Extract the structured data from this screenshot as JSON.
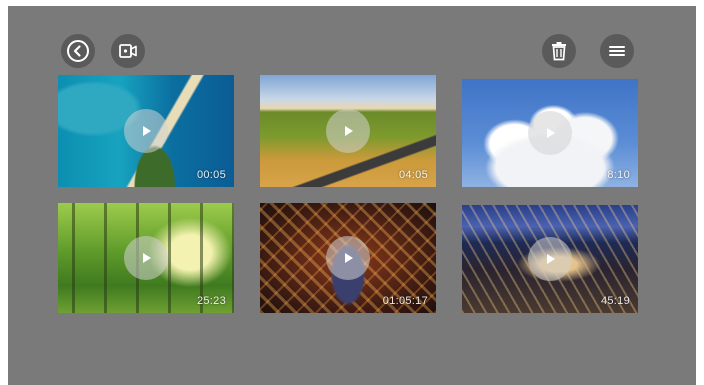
{
  "toolbar": {
    "back_icon": "back-circle-icon",
    "video_icon": "video-camera-icon",
    "trash_icon": "trash-icon",
    "menu_icon": "hamburger-menu-icon"
  },
  "videos": [
    {
      "duration": "00:05",
      "subject": "tropical island aerial"
    },
    {
      "duration": "04:05",
      "subject": "wheat field road"
    },
    {
      "duration": "8:10",
      "subject": "cumulus clouds"
    },
    {
      "duration": "25:23",
      "subject": "sunlit forest"
    },
    {
      "duration": "01:05:17",
      "subject": "city at night aerial"
    },
    {
      "duration": "45:19",
      "subject": "harbor city dusk"
    }
  ],
  "colors": {
    "background": "#7a7a7a",
    "button": "#5a5a5a",
    "icon": "#ffffff"
  }
}
